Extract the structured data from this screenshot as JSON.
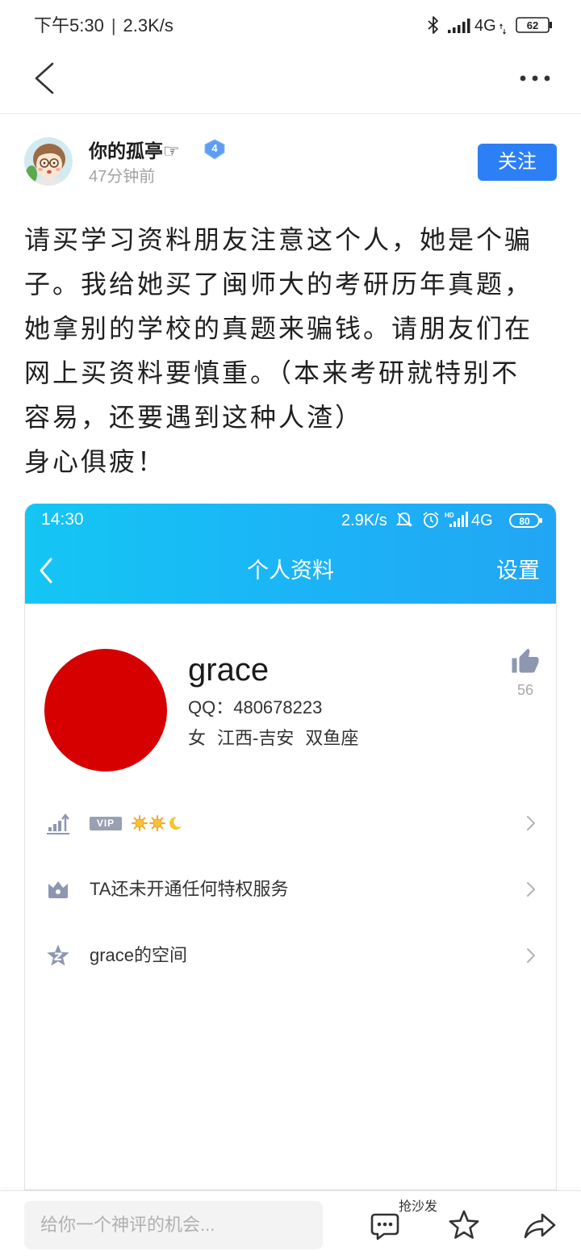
{
  "status_bar": {
    "time": "下午5:30",
    "separator": "|",
    "speed": "2.3K/s",
    "network": "4G",
    "battery": "62",
    "icons": [
      "bluetooth-icon",
      "signal-icon",
      "battery-icon"
    ]
  },
  "nav": {
    "back_icon": "chevron-left-icon",
    "more_icon": "more-dots-icon"
  },
  "post": {
    "author": {
      "name": "你的孤亭☞",
      "level_badge": "4",
      "time": "47分钟前"
    },
    "follow_label": "关注",
    "text_lines": [
      "请买学习资料朋友注意这个人，她是个骗",
      "子。我给她买了闽师大的考研历年真题，",
      "她拿别的学校的真题来骗钱。请朋友们在",
      "网上买资料要慎重。（本来考研就特别不",
      "容易，还要遇到这种人渣）",
      "身心俱疲！"
    ]
  },
  "attached_image": {
    "status_bar": {
      "time": "14:30",
      "speed": "2.9K/s",
      "network": "4G",
      "battery": "80"
    },
    "header": {
      "title": "个人资料",
      "settings_label": "设置"
    },
    "profile": {
      "name": "grace",
      "qq": "QQ：480678223",
      "gender": "女",
      "location": "江西-吉安",
      "zodiac": "双鱼座",
      "likes": "56"
    },
    "rows": [
      {
        "icon": "level-chart-icon",
        "badge": "VIP",
        "level_icons": [
          "sun-icon",
          "sun-icon",
          "moon-icon"
        ]
      },
      {
        "icon": "privilege-crown-icon",
        "label": "TA还未开通任何特权服务"
      },
      {
        "icon": "space-star-icon",
        "label": "grace的空间"
      }
    ]
  },
  "bottom_bar": {
    "comment_placeholder": "给你一个神评的机会...",
    "sofa_label": "抢沙发",
    "icons": [
      "comment-icon",
      "favorite-star-icon",
      "share-icon"
    ]
  },
  "colors": {
    "accent": "#2d7ff5",
    "header_gradient_start": "#14c6f4",
    "header_gradient_end": "#21a6f4",
    "profile_avatar": "#d60000",
    "muted_text": "#a3a3a3",
    "icon_gray": "#8e97b1"
  }
}
